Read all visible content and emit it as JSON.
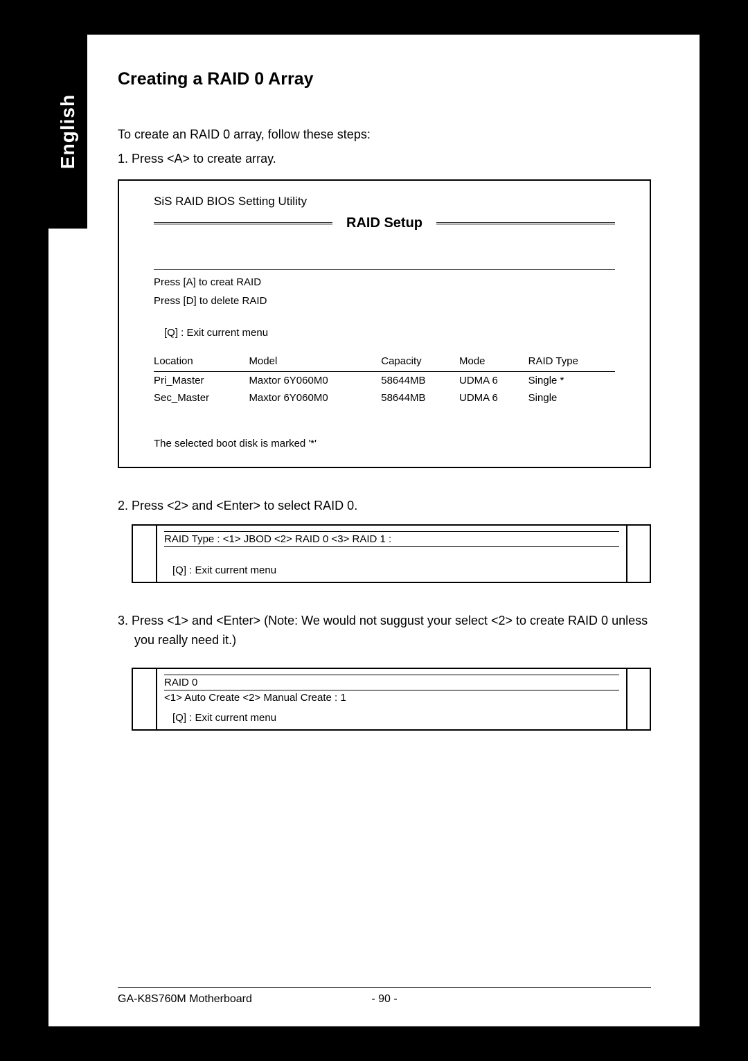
{
  "lang_tab": "English",
  "heading": "Creating a RAID 0 Array",
  "intro": "To create an RAID 0 array, follow these steps:",
  "step1": "1.  Press <A> to create array.",
  "bios": {
    "utility_title": "SiS RAID BIOS Setting Utility",
    "setup_title": "RAID Setup",
    "instr_a": "Press [A] to creat RAID",
    "instr_d": "Press [D] to delete RAID",
    "exit": "[Q] : Exit current menu",
    "headers": {
      "location": "Location",
      "model": "Model",
      "capacity": "Capacity",
      "mode": "Mode",
      "raid_type": "RAID Type"
    },
    "rows": [
      {
        "location": "Pri_Master",
        "model": "Maxtor 6Y060M0",
        "capacity": "58644MB",
        "mode": "UDMA 6",
        "raid_type": "Single *"
      },
      {
        "location": "Sec_Master",
        "model": "Maxtor 6Y060M0",
        "capacity": "58644MB",
        "mode": "UDMA 6",
        "raid_type": "Single"
      }
    ],
    "boot_note": "The selected boot disk is marked '*'"
  },
  "step2": "2.  Press <2> and <Enter> to select RAID 0.",
  "box2": {
    "line1": "RAID Type : <1> JBOD  <2> RAID 0  <3> RAID 1 :",
    "exit": "[Q] : Exit current menu"
  },
  "step3": "3.  Press <1> and <Enter> (Note: We would not suggust your select <2> to create RAID 0 unless you really need it.)",
  "box3": {
    "line1": "RAID 0",
    "line2": " <1> Auto Create  <2> Manual Create : 1",
    "exit": "[Q] : Exit current menu"
  },
  "footer": {
    "product": "GA-K8S760M Motherboard",
    "page": "- 90 -"
  }
}
